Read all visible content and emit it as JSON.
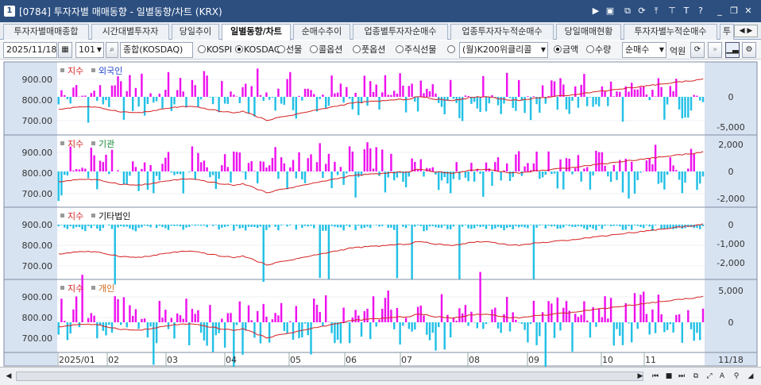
{
  "window": {
    "number": "1",
    "title": "[0784] 투자자별 매매동향 - 일별동향/차트 (KRX)"
  },
  "tabs": [
    {
      "label": "투자자별매매종합"
    },
    {
      "label": "시간대별투자자"
    },
    {
      "label": "당일추이"
    },
    {
      "label": "일별동향/차트"
    },
    {
      "label": "순매수추이"
    },
    {
      "label": "업종별투자자순매수"
    },
    {
      "label": "업종투자자누적순매수"
    },
    {
      "label": "당일매매현황"
    },
    {
      "label": "투자자별누적순매수"
    },
    {
      "label": "투"
    }
  ],
  "toolbar": {
    "date": "2025/11/18",
    "code": "101",
    "market_name": "종합(KOSDAQ)",
    "market_options": [
      {
        "label": "KOSPI",
        "checked": false
      },
      {
        "label": "KOSDAQ",
        "checked": true
      },
      {
        "label": "선물",
        "checked": false
      },
      {
        "label": "콜옵션",
        "checked": false
      },
      {
        "label": "풋옵션",
        "checked": false
      },
      {
        "label": "주식선물",
        "checked": false
      }
    ],
    "extra_select": "(월)K200위클리콜",
    "value_options": [
      {
        "label": "금액",
        "checked": true
      },
      {
        "label": "수량",
        "checked": false
      }
    ],
    "type_select": "순매수",
    "unit": "억원"
  },
  "chart": {
    "index_label": "지수",
    "colors": {
      "index": "#d42020",
      "buy": "#ee11ee",
      "sell": "#22c0e6"
    },
    "index_ticks": [
      "900.00",
      "800.00",
      "700.00"
    ],
    "x_labels": [
      "2025/01",
      "02",
      "03",
      "04",
      "05",
      "06",
      "07",
      "08",
      "09",
      "10",
      "11"
    ],
    "x_right_label": "11/18",
    "panels": [
      {
        "label": "외국인",
        "label_color": "#2244cc",
        "ticks": [
          "0",
          "-5,000"
        ]
      },
      {
        "label": "기관",
        "label_color": "#118833",
        "ticks": [
          "2,000",
          "0",
          "-2,000"
        ]
      },
      {
        "label": "기타법인",
        "label_color": "#111111",
        "ticks": [
          "0",
          "-1,000",
          "-2,000"
        ]
      },
      {
        "label": "개인",
        "label_color": "#d2691e",
        "ticks": [
          "5,000",
          "0"
        ]
      }
    ]
  }
}
